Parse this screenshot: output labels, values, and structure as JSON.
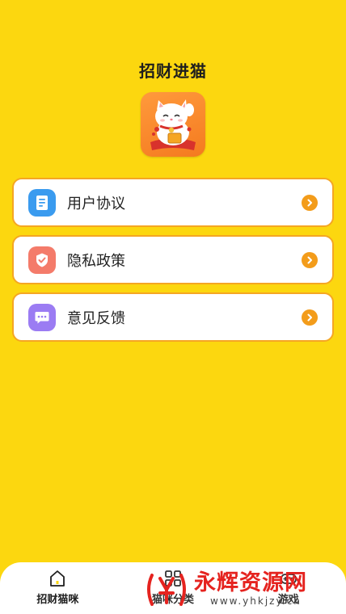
{
  "header": {
    "title": "招财进猫"
  },
  "menu": {
    "items": [
      {
        "label": "用户协议",
        "icon": "document-icon",
        "color": "#3A9BEF"
      },
      {
        "label": "隐私政策",
        "icon": "shield-check-icon",
        "color": "#F47B6A"
      },
      {
        "label": "意见反馈",
        "icon": "chat-bubble-icon",
        "color": "#9B7CF3"
      }
    ],
    "border_color": "#F5A623",
    "chevron_color": "#F39C1A"
  },
  "tabbar": {
    "tabs": [
      {
        "label": "招财猫咪",
        "icon": "home-icon"
      },
      {
        "label": "猫咪分类",
        "icon": "grid-icon"
      },
      {
        "label": "游戏",
        "icon": "gamepad-icon"
      }
    ]
  },
  "watermark": {
    "title": "永辉资源网",
    "url": "www.yhkjzy.cn"
  },
  "colors": {
    "background": "#FCD70F",
    "watermark": "#E5231F"
  }
}
